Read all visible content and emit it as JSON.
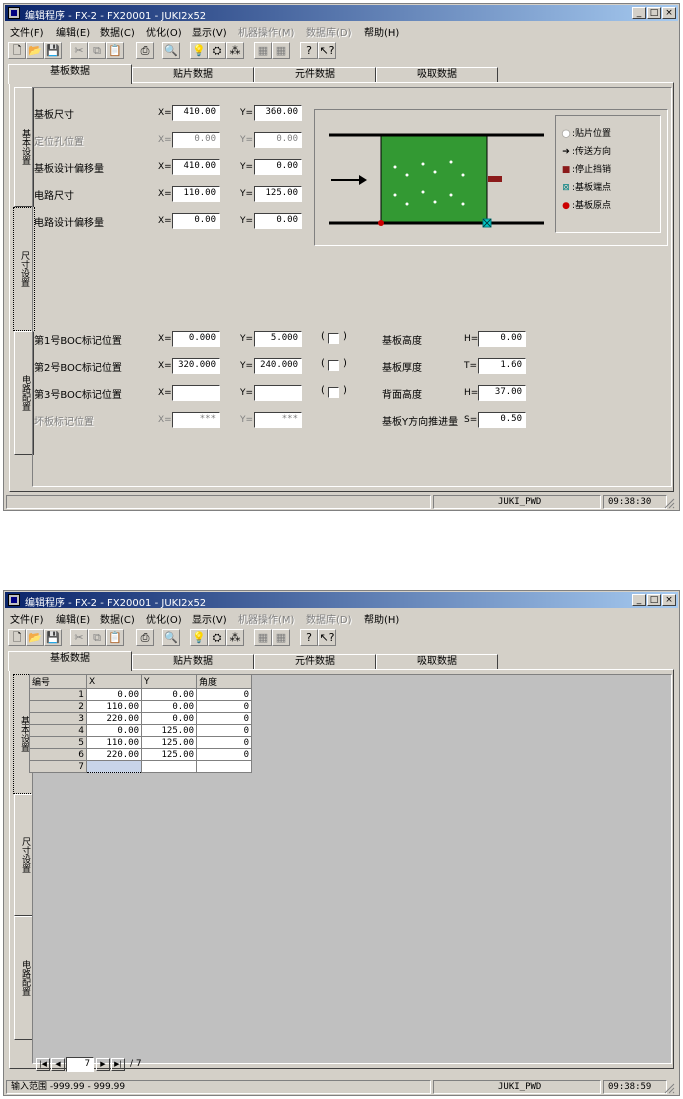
{
  "title": "编辑程序 - FX-2 - FX20001 - JUKI2x52",
  "window_buttons": [
    "_",
    "□",
    "×"
  ],
  "menus": [
    {
      "label": "文件(F)",
      "disabled": false
    },
    {
      "label": "编辑(E)",
      "disabled": false
    },
    {
      "label": "数据(C)",
      "disabled": false
    },
    {
      "label": "优化(O)",
      "disabled": false
    },
    {
      "label": "显示(V)",
      "disabled": false
    },
    {
      "label": "机器操作(M)",
      "disabled": true
    },
    {
      "label": "数据库(D)",
      "disabled": true
    },
    {
      "label": "帮助(H)",
      "disabled": false
    }
  ],
  "tabs": [
    "基板数据",
    "贴片数据",
    "元件数据",
    "吸取数据"
  ],
  "side_tabs": [
    "基本设置",
    "尺寸设置",
    "电路配置"
  ],
  "win1": {
    "rows": [
      {
        "label": "基板尺寸",
        "x": "410.00",
        "y": "360.00",
        "disabled": false
      },
      {
        "label": "定位孔位置",
        "x": "0.00",
        "y": "0.00",
        "disabled": true
      },
      {
        "label": "基板设计偏移量",
        "x": "410.00",
        "y": "0.00",
        "disabled": false
      },
      {
        "label": "电路尺寸",
        "x": "110.00",
        "y": "125.00",
        "disabled": false
      },
      {
        "label": "电路设计偏移量",
        "x": "0.00",
        "y": "0.00",
        "disabled": false
      }
    ],
    "marks": [
      {
        "label": "第1号BOC标记位置",
        "x": "0.000",
        "y": "5.000",
        "disabled": false
      },
      {
        "label": "第2号BOC标记位置",
        "x": "320.000",
        "y": "240.000",
        "disabled": false
      },
      {
        "label": "第3号BOC标记位置",
        "x": "",
        "y": "",
        "disabled": false
      },
      {
        "label": "坏板标记位置",
        "x": "***",
        "y": "***",
        "disabled": true
      }
    ],
    "heights": [
      {
        "label": "基板高度",
        "prefix": "H=",
        "value": "0.00"
      },
      {
        "label": "基板厚度",
        "prefix": "T=",
        "value": "1.60"
      },
      {
        "label": "背面高度",
        "prefix": "H=",
        "value": "37.00"
      },
      {
        "label": "基板Y方向推进量",
        "prefix": "S=",
        "value": "0.50"
      }
    ],
    "legend": [
      {
        "icon": "●",
        "text": ":贴片位置",
        "color": "#ffffff"
      },
      {
        "icon": "➔",
        "text": ":传送方向",
        "color": "#000000"
      },
      {
        "icon": "■",
        "text": ":停止挡销",
        "color": "#8b1a1a"
      },
      {
        "icon": "⊠",
        "text": ":基板端点",
        "color": "#008080"
      },
      {
        "icon": "●",
        "text": ":基板原点",
        "color": "#cc0000"
      }
    ],
    "status": [
      "",
      "JUKI_PWD",
      "09:38:30"
    ]
  },
  "win2": {
    "columns": [
      "编号",
      "X",
      "Y",
      "角度"
    ],
    "rows": [
      [
        "1",
        "0.00",
        "0.00",
        "0"
      ],
      [
        "2",
        "110.00",
        "0.00",
        "0"
      ],
      [
        "3",
        "220.00",
        "0.00",
        "0"
      ],
      [
        "4",
        "0.00",
        "125.00",
        "0"
      ],
      [
        "5",
        "110.00",
        "125.00",
        "0"
      ],
      [
        "6",
        "220.00",
        "125.00",
        "0"
      ],
      [
        "7",
        "",
        "",
        ""
      ]
    ],
    "nav": {
      "current": "7",
      "total": "/ 7"
    },
    "status": [
      "输入范围 -999.99 - 999.99",
      "JUKI_PWD",
      "09:38:59"
    ]
  },
  "colors": {
    "board": "#339933",
    "title_start": "#0a246a",
    "title_end": "#a6caf0",
    "face": "#d4d0c8"
  }
}
